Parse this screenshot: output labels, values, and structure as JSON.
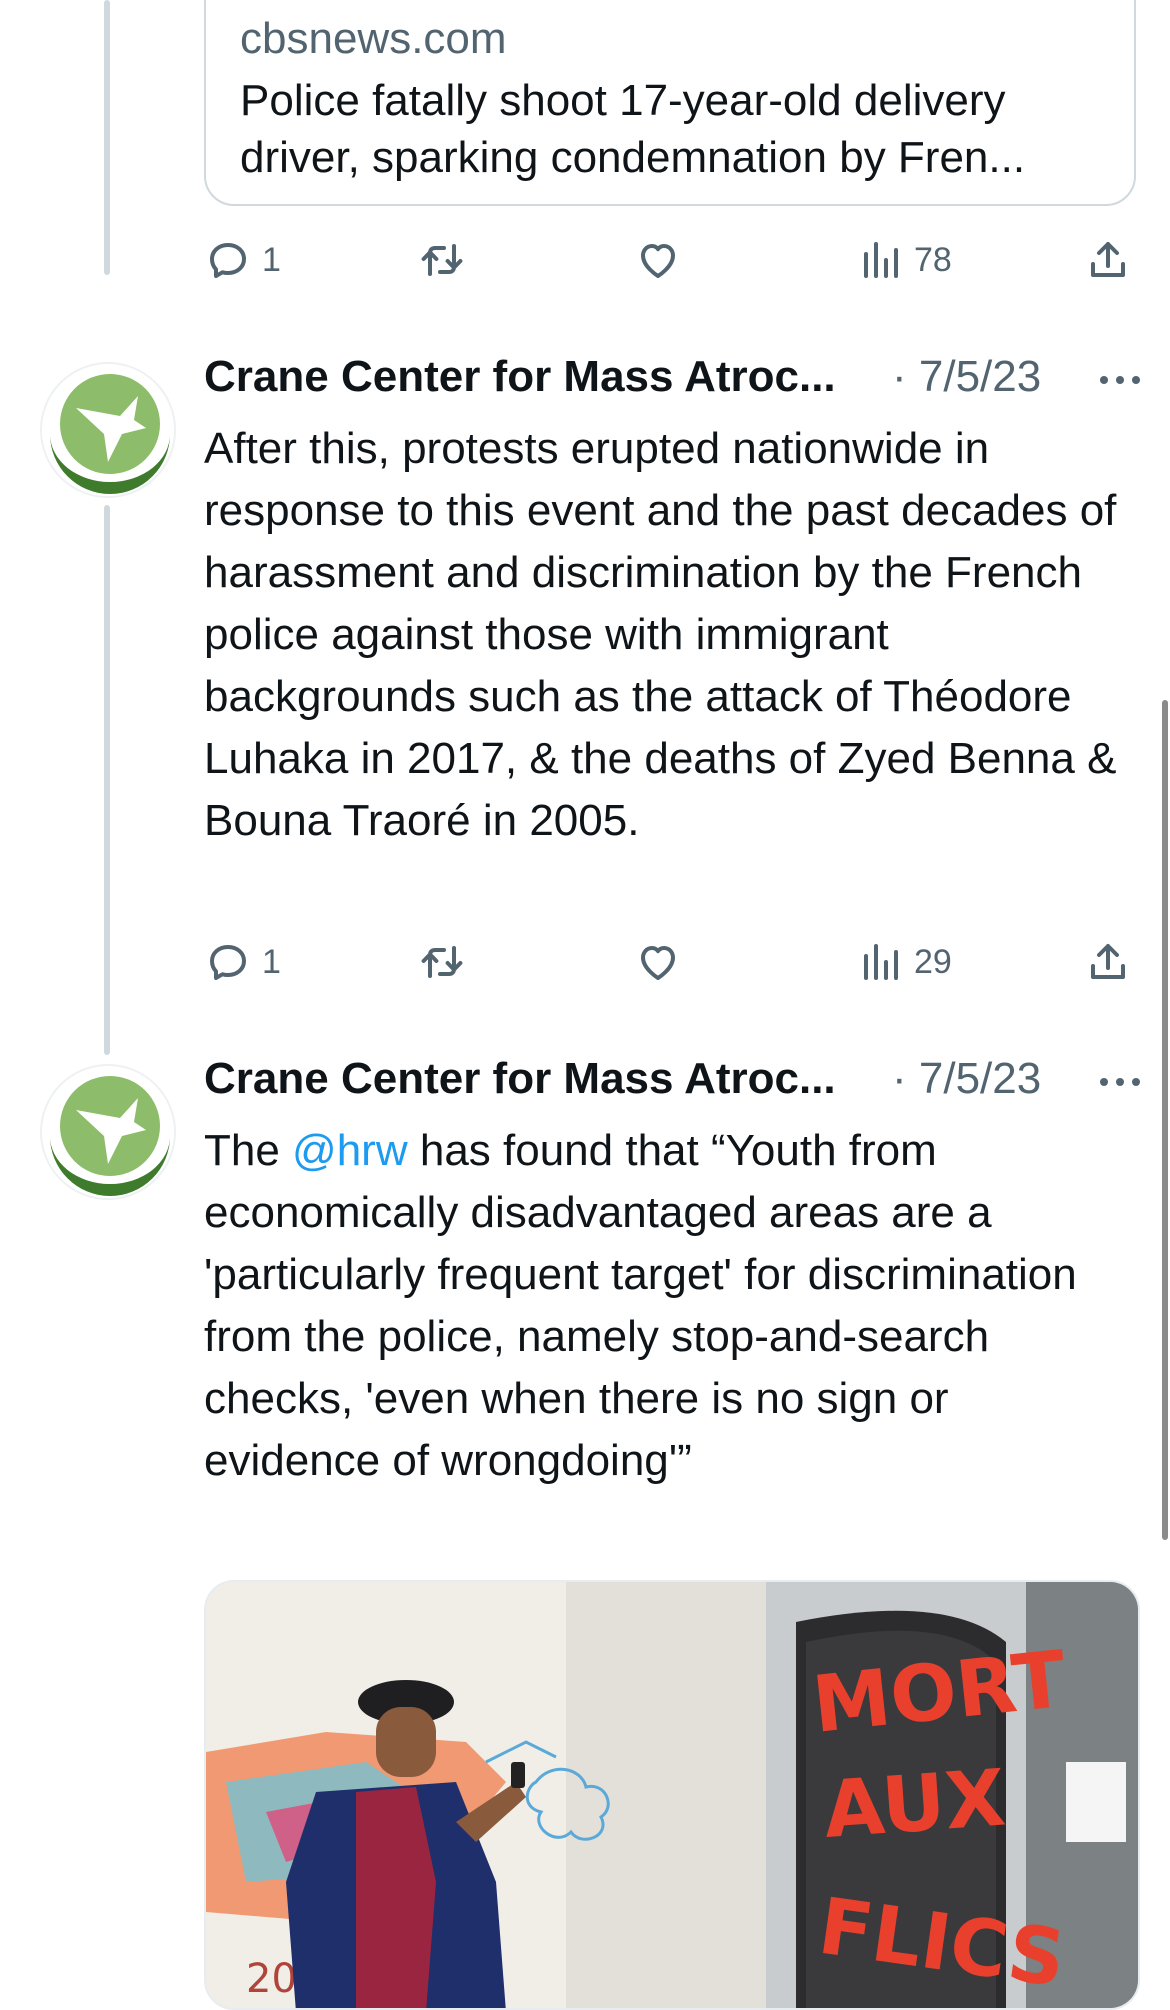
{
  "link_card": {
    "domain": "cbsnews.com",
    "title": "Police fatally shoot 17-year-old delivery driver, sparking condemnation by Fren..."
  },
  "link_actions": {
    "replies": "1",
    "views": "78"
  },
  "tweets": [
    {
      "author": "Crane Center for Mass Atroc...",
      "date": "· 7/5/23",
      "text": "After this, protests erupted nationwide in response to this event and the past decades of harassment and discrimination by the French police against those with immigrant backgrounds such as the attack of Théodore Luhaka in 2017, & the deaths of Zyed Benna & Bouna Traoré in 2005.",
      "replies": "1",
      "views": "29"
    },
    {
      "author": "Crane Center for Mass Atroc...",
      "date": "· 7/5/23",
      "text_before": "The ",
      "mention": "@hrw",
      "text_after": " has found that “Youth from economically disadvantaged areas are a 'particularly frequent target' for discrimination from the police, namely stop-and-search checks, 'even when there is no sign or evidence of wrongdoing'”",
      "media_graffiti": "MORT AUX FLICS"
    }
  ],
  "icons": {
    "reply": "reply-icon",
    "retweet": "retweet-icon",
    "like": "like-icon",
    "views": "views-icon",
    "share": "share-icon",
    "more": "more-icon"
  },
  "colors": {
    "text": "#0f1419",
    "secondary": "#536471",
    "link": "#1d9bf0",
    "avatar_green": "#4f8a3a"
  }
}
